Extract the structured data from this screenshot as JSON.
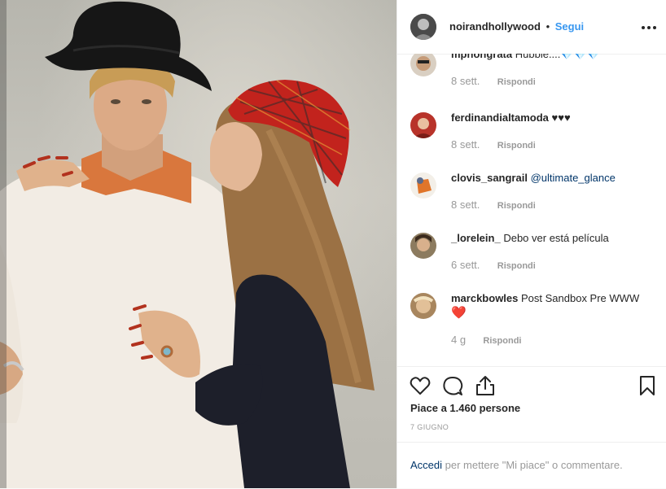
{
  "post": {
    "author": "noirandhollywood",
    "separator": "•",
    "follow_label": "Segui",
    "likes_text": "Piace a 1.460 persone",
    "date": "7 GIUGNO"
  },
  "comments": [
    {
      "user": "mphongrata",
      "text": "Hubble....💎💎💎",
      "time": "8 sett.",
      "reply": "Rispondi"
    },
    {
      "user": "ferdinandialtamoda",
      "text": "♥♥♥",
      "time": "8 sett.",
      "reply": "Rispondi"
    },
    {
      "user": "clovis_sangrail",
      "text": "@ultimate_glance",
      "time": "8 sett.",
      "reply": "Rispondi"
    },
    {
      "user": "_lorelein_",
      "text": "Debo ver está película",
      "time": "6 sett.",
      "reply": "Rispondi"
    },
    {
      "user": "marckbowles",
      "text": "Post Sandbox Pre WWW",
      "text2": "❤️",
      "time": "4 g",
      "reply": "Rispondi"
    }
  ],
  "footer": {
    "login": "Accedi",
    "rest": "per mettere \"Mi piace\" o commentare."
  },
  "icons": [
    "heart-icon",
    "comment-icon",
    "share-icon",
    "bookmark-icon",
    "more-icon"
  ],
  "colors": {
    "link": "#3897f0",
    "text": "#262626",
    "muted": "#999999",
    "mention": "#003569"
  }
}
